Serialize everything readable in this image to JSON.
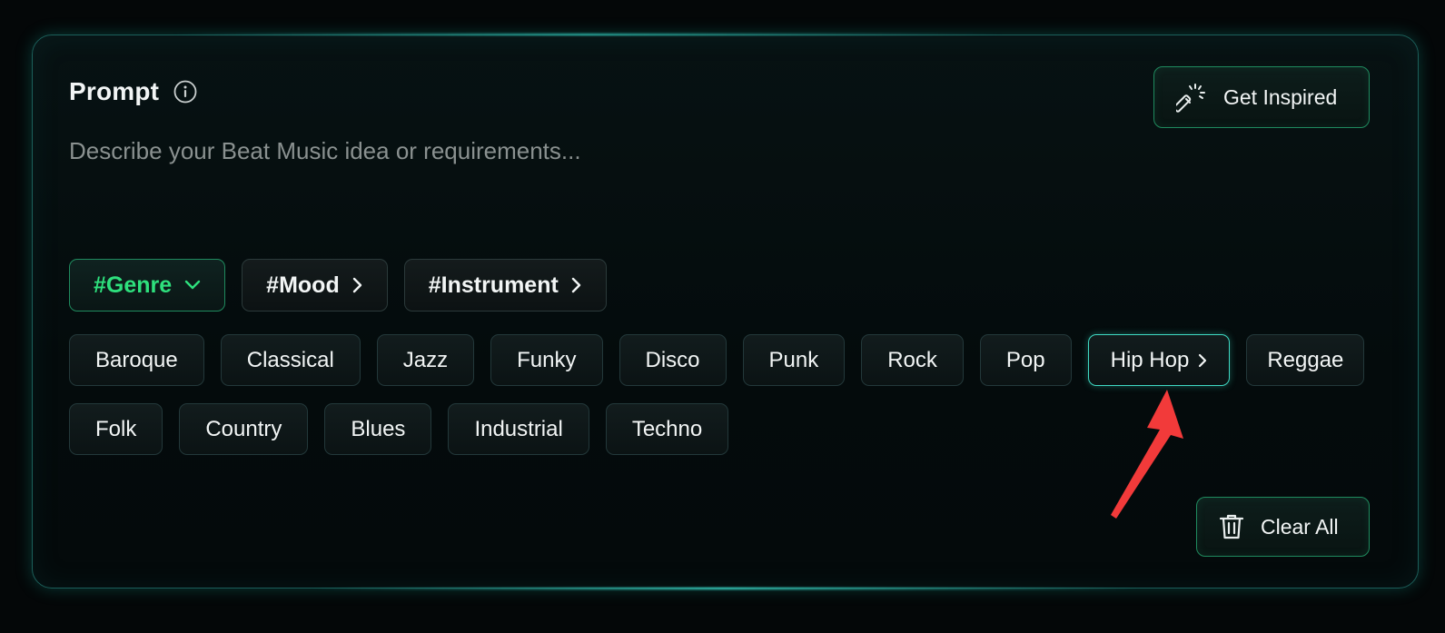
{
  "prompt": {
    "title": "Prompt",
    "placeholder": "Describe your Beat Music idea or requirements..."
  },
  "actions": {
    "inspire_label": "Get Inspired",
    "clear_label": "Clear All"
  },
  "categories": [
    {
      "label": "#Genre",
      "state": "expanded"
    },
    {
      "label": "#Mood",
      "state": "collapsed"
    },
    {
      "label": "#Instrument",
      "state": "collapsed"
    }
  ],
  "genre_tags_row1": [
    "Baroque",
    "Classical",
    "Jazz",
    "Funky",
    "Disco",
    "Punk",
    "Rock",
    "Pop",
    "Hip Hop",
    "Reggae"
  ],
  "genre_tags_row2": [
    "Folk",
    "Country",
    "Blues",
    "Industrial",
    "Techno"
  ],
  "highlighted_tag": "Hip Hop",
  "colors": {
    "accent_green": "#2ee07d",
    "border_teal": "#3fd9c3",
    "annotation_arrow": "#f23a3a"
  },
  "icons": {
    "info": "info-icon",
    "inspire": "magic-wand-icon",
    "clear": "trash-icon",
    "expanded": "chevron-down-icon",
    "collapsed": "chevron-right-icon"
  }
}
